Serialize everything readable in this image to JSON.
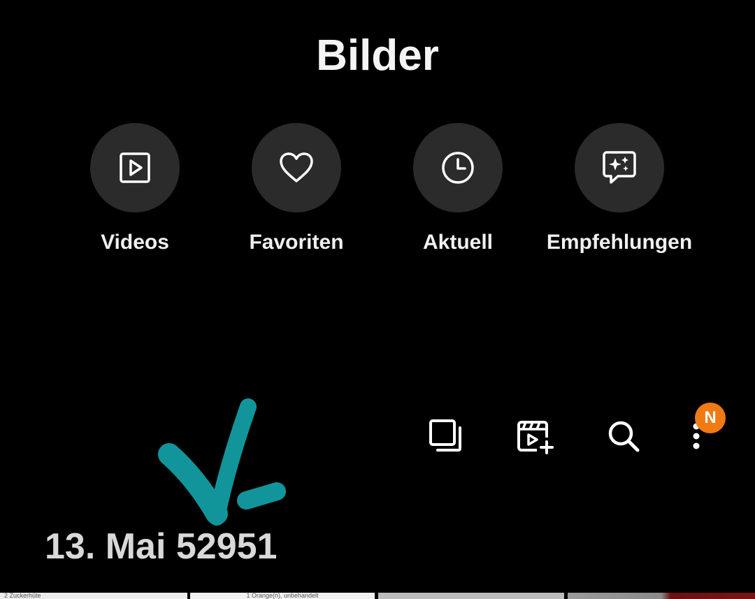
{
  "header": {
    "title": "Bilder"
  },
  "categories": [
    {
      "label": "Videos",
      "icon": "video-play-icon"
    },
    {
      "label": "Favoriten",
      "icon": "heart-icon"
    },
    {
      "label": "Aktuell",
      "icon": "clock-icon"
    },
    {
      "label": "Empfehlungen",
      "icon": "sparkle-chat-icon"
    }
  ],
  "toolbar": {
    "icons": [
      "select-copy-icon",
      "create-movie-icon",
      "search-icon",
      "more-options-icon"
    ],
    "badge": "N"
  },
  "section": {
    "date": "13. Mai 52951"
  },
  "thumbnails": [
    {
      "caption": "2 Zuckerhüte"
    },
    {
      "caption": "1   Orange(n), unbehandelt"
    },
    {
      "caption": ""
    },
    {
      "caption": ""
    }
  ],
  "colors": {
    "background": "#000000",
    "circle": "#2b2b2b",
    "badge": "#f07a14",
    "annotation": "#11959b"
  }
}
